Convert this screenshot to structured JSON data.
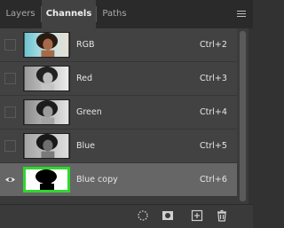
{
  "tabs": [
    {
      "label": "Layers",
      "active": false
    },
    {
      "label": "Channels",
      "active": true
    },
    {
      "label": "Paths",
      "active": false
    }
  ],
  "panel_menu_icon": "hamburger-menu-icon",
  "channels": [
    {
      "label": "RGB",
      "shortcut": "Ctrl+2",
      "visible": false,
      "selected": false,
      "thumbnail": "color-portrait"
    },
    {
      "label": "Red",
      "shortcut": "Ctrl+3",
      "visible": false,
      "selected": false,
      "thumbnail": "grayscale-portrait-light"
    },
    {
      "label": "Green",
      "shortcut": "Ctrl+4",
      "visible": false,
      "selected": false,
      "thumbnail": "grayscale-portrait"
    },
    {
      "label": "Blue",
      "shortcut": "Ctrl+5",
      "visible": false,
      "selected": false,
      "thumbnail": "grayscale-portrait-dark"
    },
    {
      "label": "Blue copy",
      "shortcut": "Ctrl+6",
      "visible": true,
      "selected": true,
      "thumbnail": "black-silhouette-on-white"
    }
  ],
  "bottom_icons": [
    "load-selection-icon",
    "save-selection-as-channel-icon",
    "new-channel-icon",
    "delete-channel-icon"
  ],
  "colors": {
    "selection_border": "#2ed82e",
    "panel_bg": "#3a3a3a",
    "row_bg": "#424242",
    "row_selected_bg": "#666666"
  }
}
